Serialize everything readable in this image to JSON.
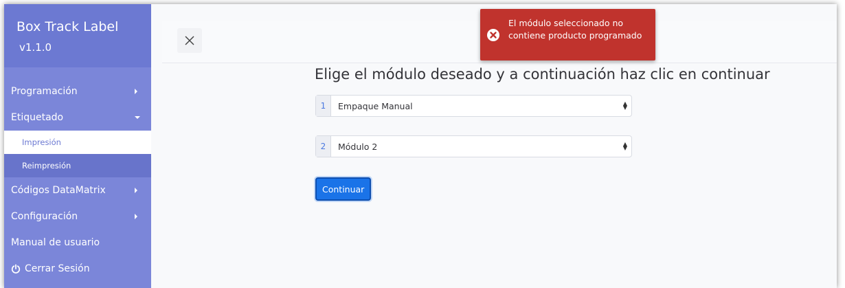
{
  "sidebar": {
    "brand_title": "Box Track Label",
    "brand_version": "v1.1.0",
    "items": [
      {
        "label": "Programación"
      },
      {
        "label": "Etiquetado"
      },
      {
        "label": "Impresión"
      },
      {
        "label": "Reimpresión"
      },
      {
        "label": "Códigos DataMatrix"
      },
      {
        "label": "Configuración"
      },
      {
        "label": "Manual de usuario"
      },
      {
        "label": "Cerrar Sesión"
      }
    ]
  },
  "main": {
    "instruction": "Elige el módulo deseado y a continuación haz clic en continuar",
    "select1": {
      "number": "1",
      "value": "Empaque Manual"
    },
    "select2": {
      "number": "2",
      "value": "Módulo 2"
    },
    "continue_label": "Continuar"
  },
  "toast": {
    "message": "El módulo seleccionado no contiene producto programado"
  },
  "colors": {
    "sidebar": "#7b86d9",
    "brand": "#6c79d2",
    "toast": "#c0332d",
    "primary": "#1a73e8"
  },
  "icons": {
    "close": "close-icon",
    "error": "error-circle-icon",
    "power": "power-icon"
  }
}
